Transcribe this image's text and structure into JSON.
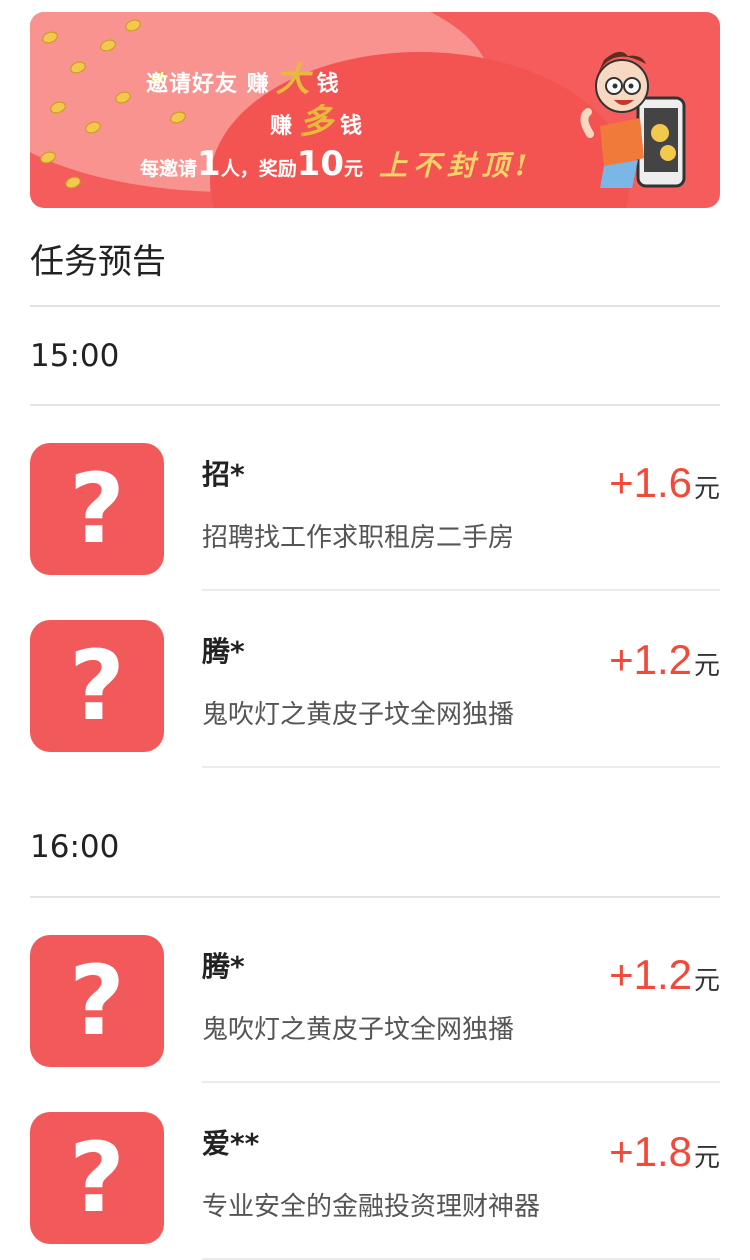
{
  "banner": {
    "line1_prefix": "邀请好友  赚",
    "line1_big": "大",
    "line1_suffix": "钱",
    "line2_prefix": "赚",
    "line2_big": "多",
    "line2_suffix": "钱",
    "line3_a": "每邀请",
    "line3_n1": "1",
    "line3_b": "人，奖励",
    "line3_n2": "10",
    "line3_c": "元",
    "slogan": "上不封顶!"
  },
  "section_title": "任务预告",
  "groups": [
    {
      "time": "15:00",
      "tasks": [
        {
          "name": "招*",
          "desc": "招聘找工作求职租房二手房",
          "reward": "+1.6",
          "unit": "元"
        },
        {
          "name": "腾*",
          "desc": "鬼吹灯之黄皮子坟全网独播",
          "reward": "+1.2",
          "unit": "元"
        }
      ]
    },
    {
      "time": "16:00",
      "tasks": [
        {
          "name": "腾*",
          "desc": "鬼吹灯之黄皮子坟全网独播",
          "reward": "+1.2",
          "unit": "元"
        },
        {
          "name": "爱**",
          "desc": "专业安全的金融投资理财神器",
          "reward": "+1.8",
          "unit": "元"
        }
      ]
    }
  ],
  "icon_glyph": "?",
  "colors": {
    "accent": "#f1493a",
    "icon_bg": "#f2595a",
    "banner_bg": "#f45d5b"
  }
}
